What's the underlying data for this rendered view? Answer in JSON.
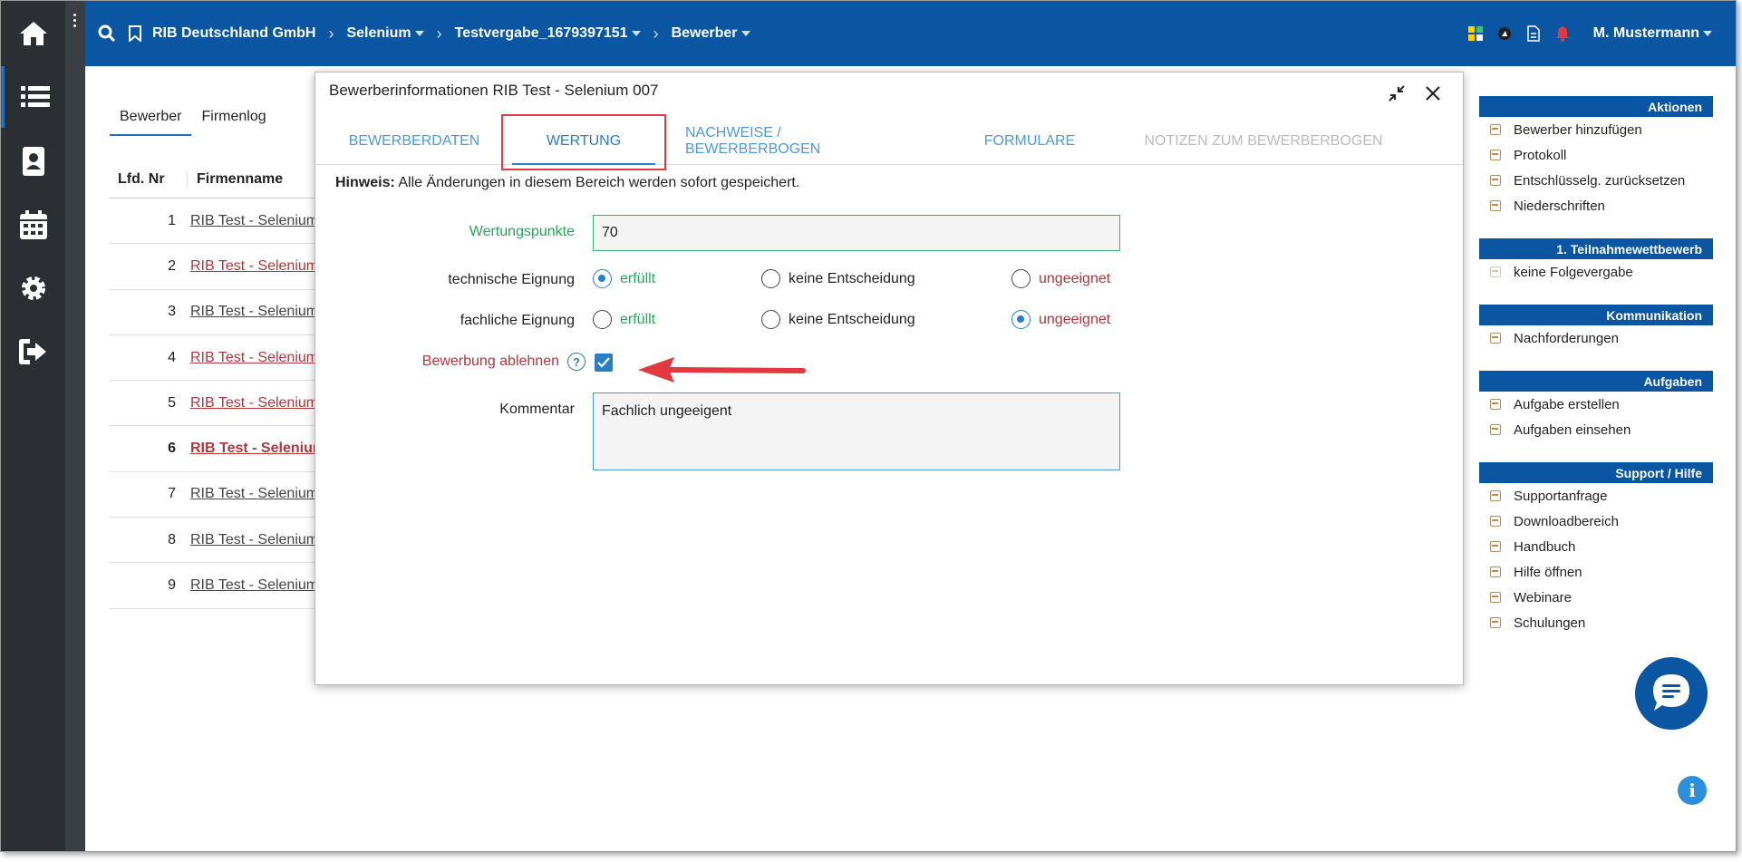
{
  "topbar": {
    "org": "RIB Deutschland GmbH",
    "crumb1": "Selenium",
    "crumb2": "Testvergabe_1679397151",
    "crumb3": "Bewerber",
    "user": "M. Mustermann"
  },
  "bg": {
    "tabs": [
      "Bewerber",
      "Firmenlog"
    ],
    "col_nr": "Lfd. Nr",
    "col_name": "Firmenname",
    "rows": [
      {
        "nr": "1",
        "name": "RIB Test - Selenium"
      },
      {
        "nr": "2",
        "name": "RIB Test - Selenium"
      },
      {
        "nr": "3",
        "name": "RIB Test - Selenium"
      },
      {
        "nr": "4",
        "name": "RIB Test - Selenium"
      },
      {
        "nr": "5",
        "name": "RIB Test - Selenium"
      },
      {
        "nr": "6",
        "name": "RIB Test - Selenium"
      },
      {
        "nr": "7",
        "name": "RIB Test - Selenium"
      },
      {
        "nr": "8",
        "name": "RIB Test - Selenium"
      },
      {
        "nr": "9",
        "name": "RIB Test - Selenium"
      }
    ]
  },
  "dialog": {
    "title": "Bewerberinformationen RIB Test - Selenium 007",
    "tabs": [
      "BEWERBERDATEN",
      "WERTUNG",
      "NACHWEISE / BEWERBERBOGEN",
      "FORMULARE",
      "NOTIZEN ZUM BEWERBERBOGEN"
    ],
    "hint_bold": "Hinweis:",
    "hint_text": " Alle Änderungen in diesem Bereich werden sofort gespeichert.",
    "wertungspunkte_label": "Wertungspunkte",
    "wertungspunkte_value": "70",
    "tech_label": "technische Eignung",
    "fach_label": "fachliche Eignung",
    "opt_erfuellt": "erfüllt",
    "opt_keine": "keine Entscheidung",
    "opt_ungeeignet": "ungeeignet",
    "ablehnen_label": "Bewerbung ablehnen",
    "kommentar_label": "Kommentar",
    "kommentar_value": "Fachlich ungeeigent"
  },
  "panel": {
    "aktionen": "Aktionen",
    "aktionen_items": [
      "Bewerber hinzufügen",
      "Protokoll",
      "Entschlüsselg. zurücksetzen",
      "Niederschriften"
    ],
    "teilnahme": "1. Teilnahmewettbewerb",
    "teilnahme_items": [
      "keine Folgevergabe"
    ],
    "kommunikation": "Kommunikation",
    "kommunikation_items": [
      "Nachforderungen"
    ],
    "aufgaben": "Aufgaben",
    "aufgaben_items": [
      "Aufgabe erstellen",
      "Aufgaben einsehen"
    ],
    "support": "Support / Hilfe",
    "support_items": [
      "Supportanfrage",
      "Downloadbereich",
      "Handbuch",
      "Hilfe öffnen",
      "Webinare",
      "Schulungen"
    ]
  },
  "colors": {
    "brand": "#0a56a3",
    "accent": "#2a7ec4",
    "ok": "#26a65b",
    "bad": "#b1373d",
    "highlight": "#e3383f"
  }
}
